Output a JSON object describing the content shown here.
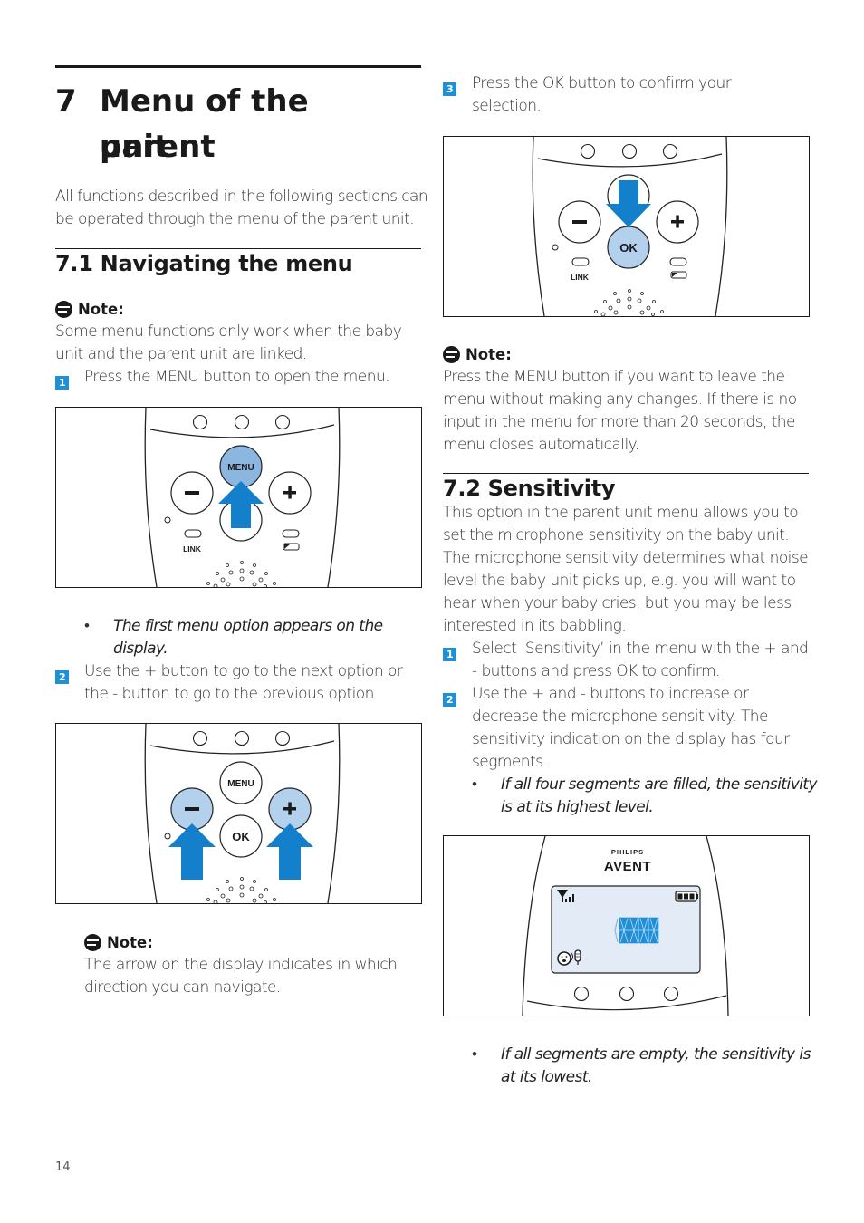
{
  "chapter": {
    "number": "7",
    "title": "Menu of the parent unit",
    "title_line1": "Menu of the parent",
    "title_line2": "unit",
    "intro_line1": "All functions described in the following sections can",
    "intro_line2": "be operated through the menu of the parent unit."
  },
  "section_7_1": {
    "heading": "7.1 Navigating the menu",
    "note1": {
      "label": "Note:",
      "line1": "Some menu functions only work when the baby",
      "line2": "unit and the parent unit are linked."
    },
    "step1": {
      "number": "1",
      "text": "Press the MENU button to open the menu."
    },
    "figure1": {
      "highlighted_button": "MENU",
      "arrow_direction": "up",
      "buttons": {
        "menu": "MENU",
        "minus": "−",
        "plus": "+",
        "link": "LINK"
      }
    },
    "bullet1": {
      "line1": "The first menu option appears on the",
      "line2": "display."
    },
    "step2": {
      "number": "2",
      "line1": "Use the + button to go to the next option or",
      "line2": "the - button to go to the previous option."
    },
    "figure2": {
      "highlighted_buttons": [
        "-",
        "+"
      ],
      "arrow_direction": "up",
      "buttons": {
        "menu": "MENU",
        "ok": "OK",
        "minus": "−",
        "plus": "+"
      }
    },
    "note2": {
      "label": "Note:",
      "line1": "The arrow on the display indicates in which",
      "line2": "direction you can navigate."
    }
  },
  "right_column": {
    "step3": {
      "number": "3",
      "line1": "Press the OK button to confirm your",
      "line2": "selection."
    },
    "figure3": {
      "highlighted_button": "OK",
      "arrow_direction": "down",
      "buttons": {
        "ok": "OK",
        "minus": "−",
        "plus": "+",
        "link": "LINK"
      }
    },
    "note3": {
      "label": "Note:",
      "line1": "Press the MENU button if you want to leave the",
      "line2": "menu without making any changes. If there is no",
      "line3": "input in the menu for more than 20 seconds, the",
      "line4": "menu closes automatically."
    }
  },
  "section_7_2": {
    "heading": "7.2 Sensitivity",
    "intro": [
      "This option in the parent unit menu allows you to",
      "set the microphone sensitivity on the baby unit.",
      "The microphone sensitivity determines what noise",
      "level the baby unit picks up, e.g. you will want to",
      "hear when your baby cries, but you may be less",
      "interested in its babbling."
    ],
    "step1": {
      "number": "1",
      "line1": "Select ‘Sensitivity’ in the menu with the + and",
      "line2": "- buttons and press OK to confirm."
    },
    "step2": {
      "number": "2",
      "line1": "Use the + and - buttons to increase or",
      "line2": "decrease the microphone sensitivity. The",
      "line3": "sensitivity indication on the display has four",
      "line4": "segments."
    },
    "bullet1": {
      "line1": " If all four segments are filled, the sensitivity",
      "line2": "is at its highest level."
    },
    "figure4": {
      "brand_top": "PHILIPS",
      "brand_bottom": "AVENT",
      "sensitivity_segments_filled": 4,
      "sensitivity_segments_total": 4,
      "signal_bars": 3,
      "battery_bars": 3,
      "lcd_color": "#e3ebf6",
      "segment_color": "#1f8fd6"
    },
    "bullet2": {
      "line1": "If all segments are empty, the sensitivity is",
      "line2": "at its lowest."
    }
  },
  "footer": {
    "page_number": "14"
  },
  "colors": {
    "accent": "#1f8fd6",
    "arrow": "#1480cc",
    "highlight_button": "#8ab6e0",
    "highlight_button_light": "#b3d0ec"
  }
}
